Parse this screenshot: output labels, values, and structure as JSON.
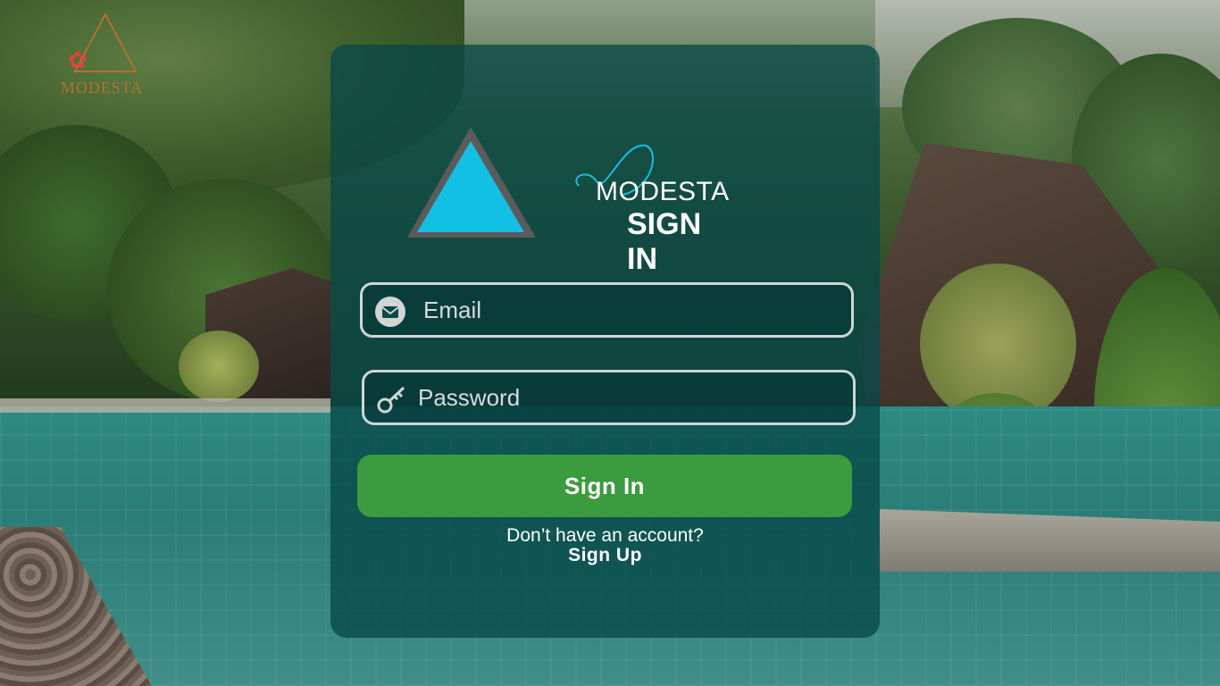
{
  "corner_logo": {
    "text": "MODESTA",
    "accent": "#b4732f",
    "icon": "flower-icon"
  },
  "brand": {
    "name": "MODESTA",
    "title": "SIGN IN",
    "triangle_color": "#12c0e3"
  },
  "form": {
    "email_placeholder": "Email",
    "email_icon": "envelope-icon",
    "password_placeholder": "Password",
    "password_icon": "key-icon",
    "submit_label": "Sign In",
    "submit_color": "#3a9b3f"
  },
  "footer": {
    "prompt": "Don’t have an account?",
    "signup_label": "Sign Up"
  },
  "colors": {
    "panel": "#084848",
    "text": "#ffffff",
    "field_border": "#cfd6d4"
  }
}
